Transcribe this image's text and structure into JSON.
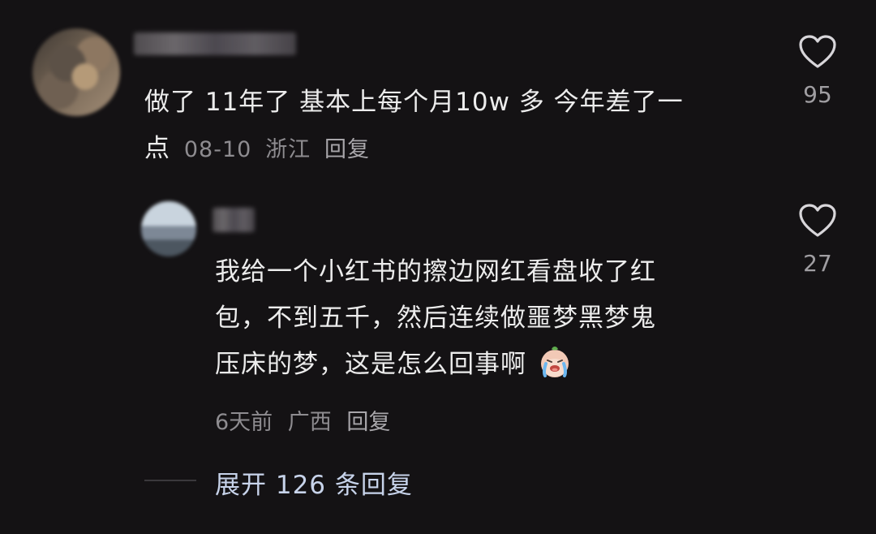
{
  "comment": {
    "text_line1": "做了 11年了 基本上每个月10w 多 今年差了一",
    "text_line2": "点",
    "date": "08-10",
    "location": "浙江",
    "reply_label": "回复",
    "like_count": "95",
    "like_icon": "heart-outline-icon"
  },
  "reply": {
    "text_line1": "我给一个小红书的擦边网红看盘收了红",
    "text_line2": "包，不到五千，然后连续做噩梦黑梦鬼",
    "text_line3": "压床的梦，这是怎么回事啊",
    "emoji": "crying-face-emoji",
    "date": "6天前",
    "location": "广西",
    "reply_label": "回复",
    "like_count": "27",
    "like_icon": "heart-outline-icon"
  },
  "expand_replies": {
    "label": "展开 126 条回复"
  },
  "colors": {
    "background": "#141214",
    "text": "#ececec",
    "meta": "#8e8c90",
    "expand_link": "#c7d3ea"
  }
}
